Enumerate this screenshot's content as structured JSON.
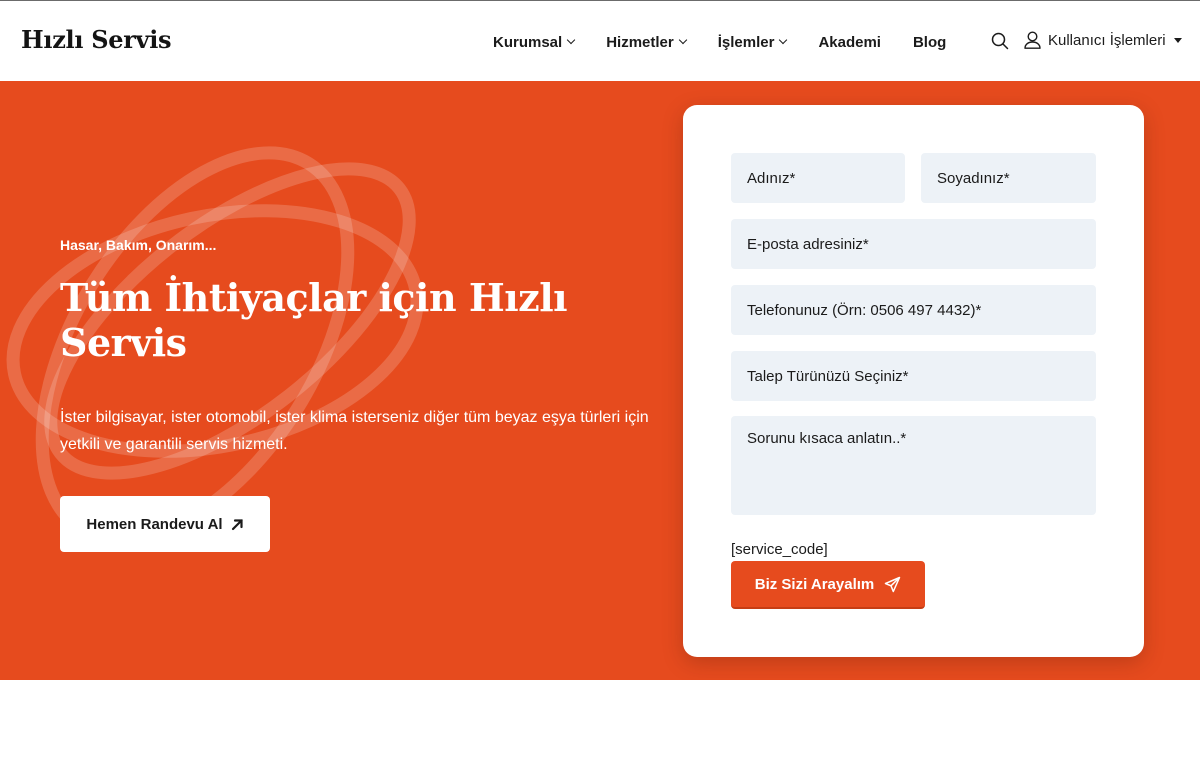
{
  "brand": {
    "logo_text": "Hızlı Servis",
    "accent_color": "#e64b1e"
  },
  "nav": {
    "items": [
      {
        "label": "Kurumsal",
        "has_dropdown": true
      },
      {
        "label": "Hizmetler",
        "has_dropdown": true
      },
      {
        "label": "İşlemler",
        "has_dropdown": true
      },
      {
        "label": "Akademi",
        "has_dropdown": false
      },
      {
        "label": "Blog",
        "has_dropdown": false
      }
    ],
    "search_icon": "search-icon",
    "user_menu_label": "Kullanıcı İşlemleri",
    "user_icon": "user-icon"
  },
  "hero": {
    "subtitle": "Hasar, Bakım, Onarım...",
    "title": "Tüm İhtiyaçlar için Hızlı Servis",
    "description": "İster bilgisayar, ister otomobil, ister klima isterseniz diğer tüm beyaz eşya türleri için yetkili ve garantili servis hizmeti.",
    "cta_label": "Hemen Randevu Al",
    "cta_icon": "arrow-up-right-icon"
  },
  "form": {
    "name_placeholder": "Adınız*",
    "surname_placeholder": "Soyadınız*",
    "email_placeholder": "E-posta adresiniz*",
    "phone_placeholder": "Telefonunuz (Örn: 0506 497 4432)*",
    "request_type_label": "Talep Türünüzü Seçiniz*",
    "message_placeholder": "Sorunu kısaca anlatın..*",
    "shortcode_text": "[service_code]",
    "submit_label": "Biz Sizi Arayalım",
    "submit_icon": "send-icon"
  }
}
